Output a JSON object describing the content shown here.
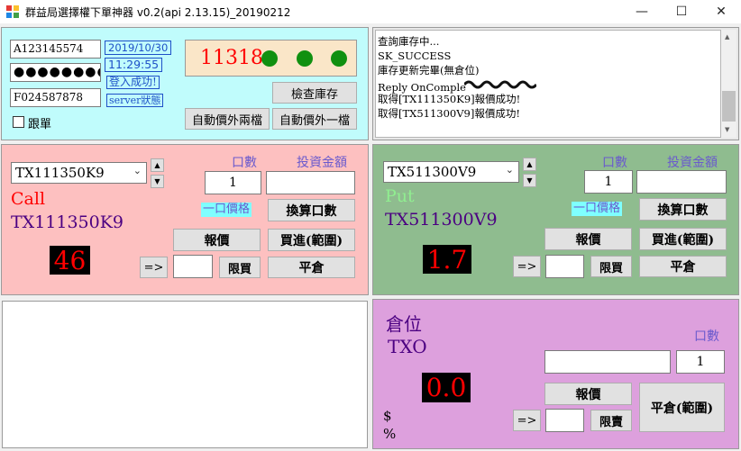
{
  "window": {
    "title": "群益局選擇權下單神器 v0.2(api 2.13.15)_20190212",
    "minimize": "—",
    "maximize": "☐",
    "close": "✕"
  },
  "login": {
    "account": "A123145574",
    "password": "●●●●●●●●●",
    "futures_account": "F024587878",
    "date": "2019/10/30",
    "time": "11:29:55",
    "status": "登入成功!",
    "server_status": "server狀態",
    "follow_label": "跟單",
    "ticker_value": "11318",
    "check_inventory": "檢查庫存",
    "auto_out_two": "自動價外兩檔",
    "auto_out_one": "自動價外一檔"
  },
  "log": {
    "lines": [
      "查詢庫存中...",
      "SK_SUCCESS",
      "庫存更新完畢(無倉位)",
      "Reply OnComple",
      "取得[TX111350K9]報價成功!",
      "取得[TX511300V9]報價成功!"
    ]
  },
  "call": {
    "symbol": "TX111350K9",
    "type": "Call",
    "name": "TX111350K9",
    "price": "46",
    "lots_label": "口數",
    "amount_label": "投資金額",
    "lots": "1",
    "amount": "",
    "one_lot_price": "一口價格",
    "convert_lots": "換算口數",
    "quote": "報價",
    "buy_range": "買進(範圍)",
    "arrow": "=>",
    "limit_buy": "限買",
    "close_position": "平倉"
  },
  "put": {
    "symbol": "TX511300V9",
    "type": "Put",
    "name": "TX511300V9",
    "price": "1.7",
    "lots_label": "口數",
    "amount_label": "投資金額",
    "lots": "1",
    "amount": "",
    "one_lot_price": "一口價格",
    "convert_lots": "換算口數",
    "quote": "報價",
    "buy_range": "買進(範圍)",
    "arrow": "=>",
    "limit_buy": "限買",
    "close_position": "平倉"
  },
  "position": {
    "title": "倉位",
    "market": "TXO",
    "lots_label": "口數",
    "symbol": "",
    "lots": "1",
    "value": "0.0",
    "dollar": "$",
    "percent": "%",
    "quote": "報價",
    "close_range": "平倉(範圍)",
    "arrow": "=>",
    "limit_sell": "限賣"
  },
  "colors": {
    "login_bg": "#c0fcfc",
    "call_bg": "#fdc0c0",
    "put_bg": "#8fbc8f",
    "position_bg": "#dda0dd",
    "ticker_bg": "#fae6c8",
    "led_red": "#ff0000",
    "call_red": "#ff0000",
    "put_green": "#90ee90",
    "name_purple": "#4b0082",
    "label_blue": "#6a5acd",
    "highlight": "#7fffff"
  }
}
